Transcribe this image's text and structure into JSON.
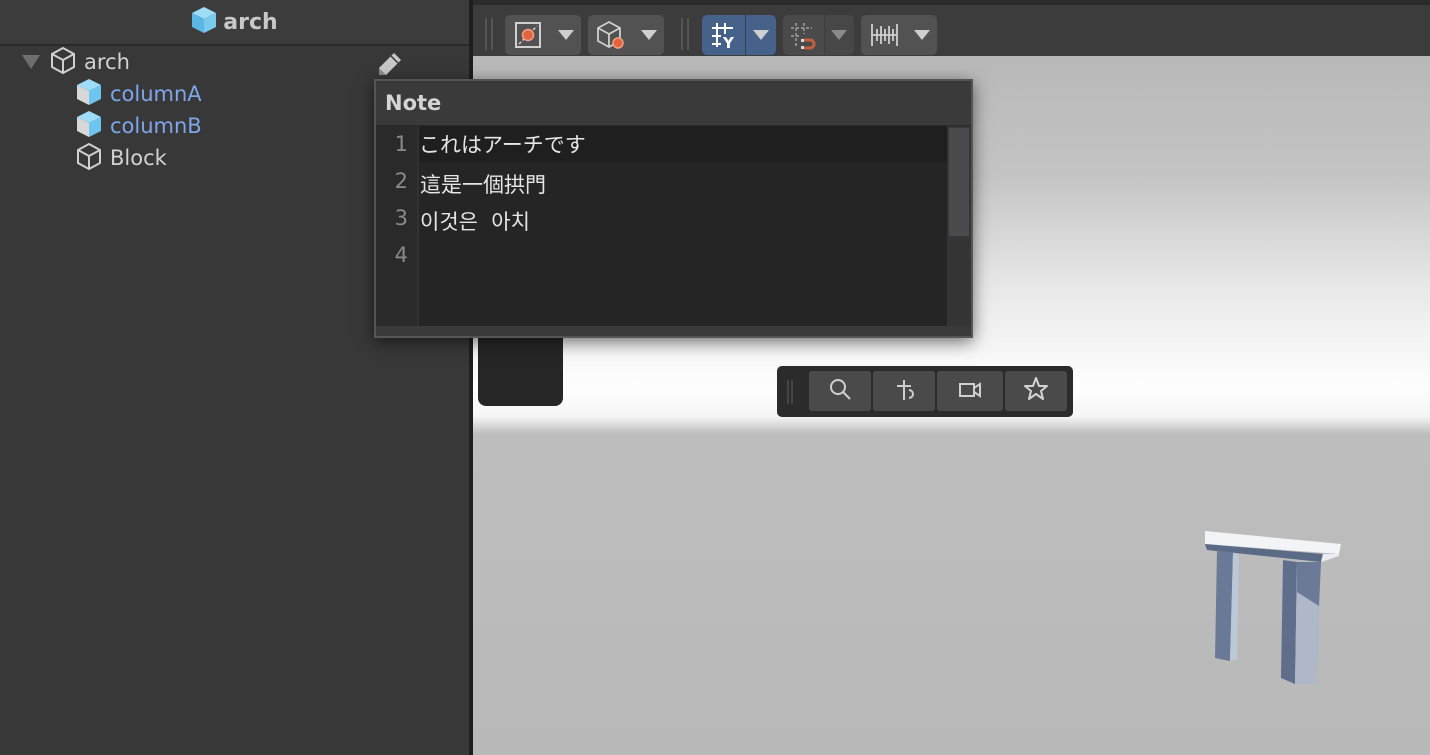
{
  "hierarchy": {
    "header_title": "arch",
    "header_icon": "prefab-cube-icon",
    "items": [
      {
        "label": "arch",
        "icon": "gameobject-cube-outline-icon",
        "expanded": true,
        "depth": 0,
        "type": "gameobject"
      },
      {
        "label": "columnA",
        "icon": "prefab-cube-icon",
        "depth": 1,
        "type": "prefab"
      },
      {
        "label": "columnB",
        "icon": "prefab-cube-icon",
        "depth": 1,
        "type": "prefab"
      },
      {
        "label": "Block",
        "icon": "gameobject-cube-outline-icon",
        "depth": 1,
        "type": "gameobject"
      }
    ],
    "edit_note_icon": "pencil-icon"
  },
  "scene_toolbar": {
    "buttons": [
      {
        "name": "pivot-tool",
        "icon": "pivot-handle-icon",
        "has_dropdown": true,
        "active": false
      },
      {
        "name": "orientation-tool",
        "icon": "cube-origin-icon",
        "has_dropdown": true,
        "active": false
      },
      {
        "name": "grid-toggle",
        "icon": "grid-y-icon",
        "has_dropdown": true,
        "active": true
      },
      {
        "name": "grid-snap",
        "icon": "grid-magnet-icon",
        "has_dropdown": true,
        "active": false,
        "disabled": true
      },
      {
        "name": "increment-snap",
        "icon": "ruler-ticks-icon",
        "has_dropdown": true,
        "active": false
      }
    ],
    "colors": {
      "active": "#46618a",
      "accent_orange": "#e2643f"
    }
  },
  "overlay_toolbar": {
    "buttons": [
      {
        "icon": "search-icon"
      },
      {
        "icon": "pin-icon"
      },
      {
        "icon": "camera-icon"
      },
      {
        "icon": "star-icon"
      }
    ]
  },
  "note": {
    "title": "Note",
    "lines": [
      {
        "number": "1",
        "text": "これはアーチです"
      },
      {
        "number": "2",
        "text": "這是一個拱門"
      },
      {
        "number": "3",
        "text": "이것은  아치"
      },
      {
        "number": "4",
        "text": ""
      }
    ]
  },
  "colors": {
    "prefab_label": "#7fa6ea",
    "prefab_icon": "#6ec6f0",
    "panel_bg": "#383838"
  }
}
